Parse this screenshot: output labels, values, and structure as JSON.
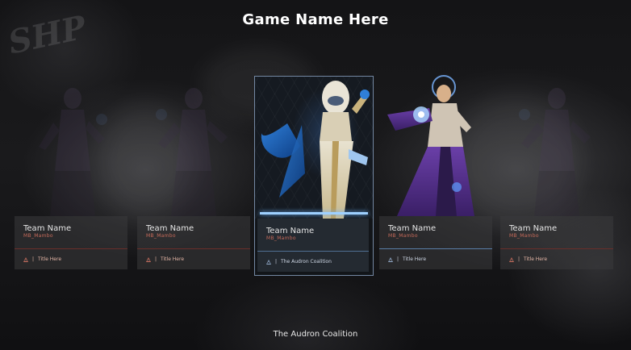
{
  "game": {
    "title": "Game Name Here"
  },
  "background": {
    "logo_text": "SHP"
  },
  "cards": [
    {
      "team_name": "Team Name",
      "handle": "MB_Mambo",
      "tag": "Title Here",
      "state": "dim",
      "art_icon": "hero-silhouette-icon"
    },
    {
      "team_name": "Team Name",
      "handle": "MB_Mambo",
      "tag": "Title Here",
      "state": "dim",
      "art_icon": "hero-silhouette-icon"
    },
    {
      "team_name": "Team Name",
      "handle": "MB_Mambo",
      "tag": "The Audron Coalition",
      "state": "selected",
      "art_icon": "white-armored-hero-icon"
    },
    {
      "team_name": "Team Name",
      "handle": "MB_Mambo",
      "tag": "Title Here",
      "state": "hover",
      "art_icon": "purple-mage-hero-icon"
    },
    {
      "team_name": "Team Name",
      "handle": "MB_Mambo",
      "tag": "Title Here",
      "state": "dim",
      "art_icon": "hero-silhouette-icon"
    }
  ],
  "footer": {
    "faction_label": "The Audron Coalition"
  },
  "colors": {
    "accent_blue": "#9ed0ff",
    "accent_red": "#c56a5a",
    "panel": "#3a3a3c"
  }
}
